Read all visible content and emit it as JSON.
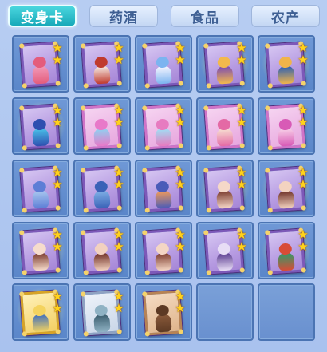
{
  "tabs": [
    {
      "label": "变身卡",
      "active": true
    },
    {
      "label": "药酒",
      "active": false
    },
    {
      "label": "食品",
      "active": false
    },
    {
      "label": "农产",
      "active": false
    }
  ],
  "slots": [
    {
      "id": "card-pink-flower-fairy",
      "frame": "purple",
      "glow": false,
      "stars": 2,
      "colors": [
        "#f19ab9",
        "#e45c7c"
      ]
    },
    {
      "id": "card-cow-king",
      "frame": "purple",
      "glow": false,
      "stars": 2,
      "colors": [
        "#f5ede6",
        "#c03a2d"
      ]
    },
    {
      "id": "card-bunny-spirit",
      "frame": "purple",
      "glow": false,
      "stars": 2,
      "colors": [
        "#f8f6ff",
        "#7bb4f0"
      ]
    },
    {
      "id": "card-violet-dancer",
      "frame": "purple",
      "glow": true,
      "stars": 2,
      "colors": [
        "#7a4ab4",
        "#f3b94c"
      ]
    },
    {
      "id": "card-blue-dragon-lady",
      "frame": "purple",
      "glow": true,
      "stars": 2,
      "colors": [
        "#2a5fb5",
        "#f0b44a"
      ]
    },
    {
      "id": "card-crystal-deer",
      "frame": "purple",
      "glow": true,
      "stars": 2,
      "colors": [
        "#4ac3e9",
        "#2e4fb0"
      ]
    },
    {
      "id": "card-azure-fairy",
      "frame": "pink",
      "glow": false,
      "stars": 2,
      "colors": [
        "#8ed3f2",
        "#e879c9"
      ]
    },
    {
      "id": "card-sky-maiden",
      "frame": "pink",
      "glow": false,
      "stars": 2,
      "colors": [
        "#9fe0f5",
        "#e77bc0"
      ]
    },
    {
      "id": "card-jade-rabbit",
      "frame": "pink",
      "glow": false,
      "stars": 2,
      "colors": [
        "#f7e1d2",
        "#e46aa5"
      ]
    },
    {
      "id": "card-lotus-sprite",
      "frame": "pink",
      "glow": false,
      "stars": 2,
      "colors": [
        "#f8d1e8",
        "#d85ab6"
      ]
    },
    {
      "id": "card-wind-dancer",
      "frame": "purple",
      "glow": false,
      "stars": 2,
      "colors": [
        "#a9c7ef",
        "#5d7ed6"
      ]
    },
    {
      "id": "card-storm-beast",
      "frame": "purple",
      "glow": false,
      "stars": 2,
      "colors": [
        "#7fb0e6",
        "#3a62b7"
      ]
    },
    {
      "id": "card-fire-monkey",
      "frame": "purple",
      "glow": false,
      "stars": 2,
      "colors": [
        "#f29b59",
        "#4a5bb8"
      ]
    },
    {
      "id": "card-bat-wing-lady-a",
      "frame": "purple",
      "glow": true,
      "stars": 2,
      "colors": [
        "#7a3a2d",
        "#f5d8c8"
      ]
    },
    {
      "id": "card-bat-wing-lady-b",
      "frame": "purple",
      "glow": true,
      "stars": 2,
      "colors": [
        "#6d2f26",
        "#f3d3c0"
      ]
    },
    {
      "id": "card-bat-wing-lady-c",
      "frame": "purple",
      "glow": true,
      "stars": 2,
      "colors": [
        "#7a3a2d",
        "#f6dccc"
      ]
    },
    {
      "id": "card-bat-wing-lady-d",
      "frame": "purple",
      "glow": false,
      "stars": 2,
      "colors": [
        "#6e2e24",
        "#f2d1bf"
      ]
    },
    {
      "id": "card-bat-wing-lady-e",
      "frame": "purple",
      "glow": false,
      "stars": 2,
      "colors": [
        "#7c3b2c",
        "#f4d6c4"
      ]
    },
    {
      "id": "card-moon-priestess",
      "frame": "purple",
      "glow": false,
      "stars": 2,
      "colors": [
        "#5a3b8f",
        "#e8ddf5"
      ]
    },
    {
      "id": "card-serpent-dragon",
      "frame": "purple",
      "glow": true,
      "stars": 2,
      "colors": [
        "#2f9b6a",
        "#d84c36"
      ]
    },
    {
      "id": "card-golden-immortal",
      "frame": "gold",
      "glow": true,
      "stars": 2,
      "colors": [
        "#3f6fbf",
        "#f4d35e"
      ]
    },
    {
      "id": "card-armored-warrior",
      "frame": "silver",
      "glow": false,
      "stars": 2,
      "colors": [
        "#3b5d6e",
        "#8fb2c4"
      ]
    },
    {
      "id": "card-brown-bear",
      "frame": "bronze",
      "glow": false,
      "stars": 2,
      "colors": [
        "#8a5a3a",
        "#5d3a24"
      ]
    },
    {
      "id": "empty-slot-1",
      "frame": "none",
      "glow": false,
      "stars": 0,
      "colors": []
    },
    {
      "id": "empty-slot-2",
      "frame": "none",
      "glow": false,
      "stars": 0,
      "colors": []
    }
  ]
}
